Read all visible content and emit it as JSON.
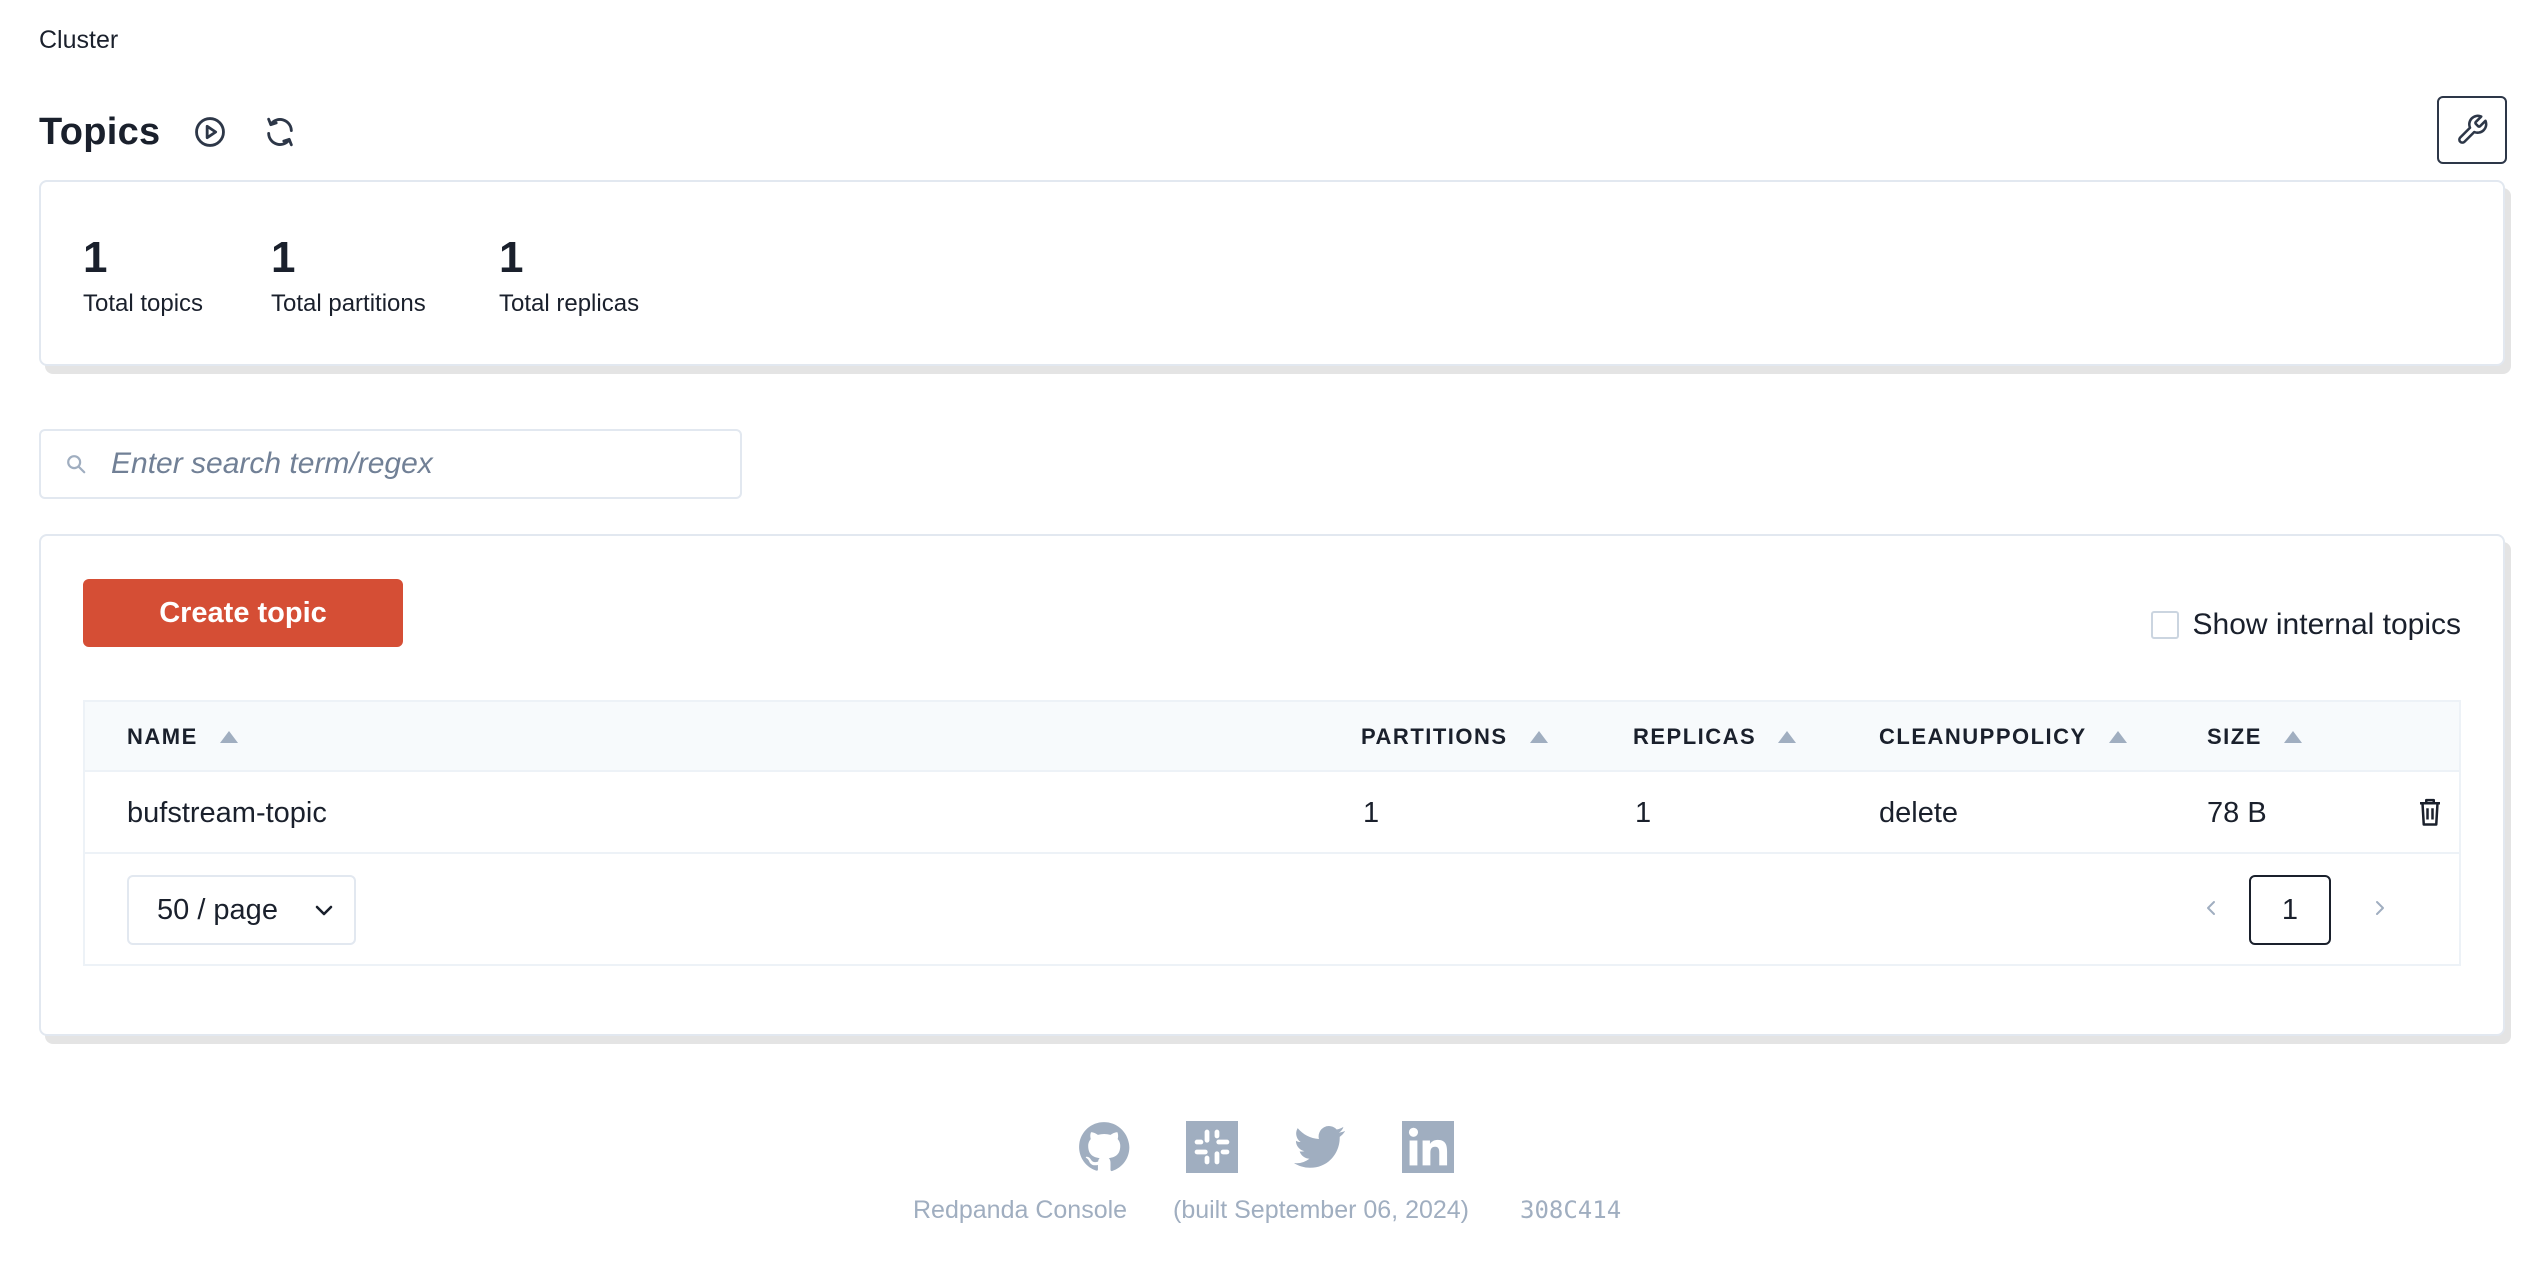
{
  "breadcrumb": {
    "label": "Cluster"
  },
  "header": {
    "title": "Topics"
  },
  "stats": [
    {
      "value": "1",
      "label": "Total topics"
    },
    {
      "value": "1",
      "label": "Total partitions"
    },
    {
      "value": "1",
      "label": "Total replicas"
    }
  ],
  "search": {
    "placeholder": "Enter search term/regex",
    "value": ""
  },
  "toolbar": {
    "create_label": "Create topic",
    "internal_label": "Show internal topics",
    "internal_checked": false
  },
  "table": {
    "columns": [
      "NAME",
      "PARTITIONS",
      "REPLICAS",
      "CLEANUPPOLICY",
      "SIZE"
    ],
    "rows": [
      {
        "name": "bufstream-topic",
        "partitions": "1",
        "replicas": "1",
        "cleanup": "delete",
        "size": "78 B"
      }
    ]
  },
  "pagination": {
    "page_size": "50 / page",
    "current_page": "1"
  },
  "footer": {
    "app_name": "Redpanda Console",
    "built": "(built September 06, 2024)",
    "hash": "308C414",
    "icons": [
      "github-icon",
      "slack-icon",
      "twitter-icon",
      "linkedin-icon"
    ]
  },
  "colors": {
    "accent": "#d54e35",
    "muted": "#a0aec0",
    "text": "#1a202c"
  }
}
